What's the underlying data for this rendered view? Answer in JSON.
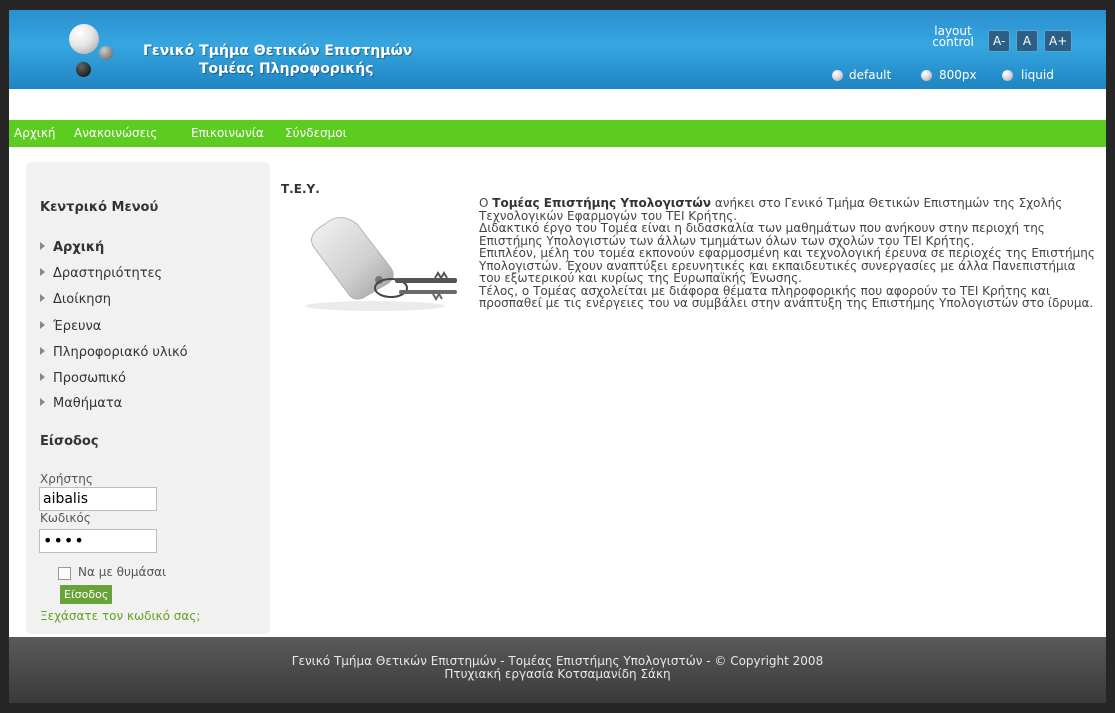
{
  "header": {
    "title_line1": "Γενικό Τμήμα Θετικών Επιστημών",
    "title_line2": "Τομέας Πληροφορικής",
    "layout_control_line1": "layout",
    "layout_control_line2": "control",
    "font_buttons": [
      "A-",
      "A",
      "A+"
    ],
    "layout_options": [
      "default",
      "800px",
      "liquid"
    ]
  },
  "nav": {
    "items": [
      "Αρχική",
      "Ανακοινώσεις",
      "Επικοινωνία",
      "Σύνδεσμοι"
    ]
  },
  "sidebar": {
    "menu_heading": "Κεντρικό Μενού",
    "menu_items": [
      "Αρχική",
      "Δραστηριότητες",
      "Διοίκηση",
      "Έρευνα",
      "Πληροφοριακό υλικό",
      "Προσωπικό",
      "Μαθήματα"
    ],
    "login_heading": "Είσοδος",
    "username_label": "Χρήστης",
    "username_value": "aibalis",
    "password_label": "Κωδικός",
    "password_value": "••••",
    "remember_label": "Να με θυμάσαι",
    "login_button": "Είσοδος",
    "forgot_link": "Ξεχάσατε τον κωδικό σας;"
  },
  "content": {
    "title": "Τ.Ε.Υ.",
    "intro_bold": "Τομέας Επιστήμης Υπολογιστών",
    "p1_pre": "Ο ",
    "p1_post": " ανήκει στο Γενικό Τμήμα Θετικών Επιστημών της Σχολής Τεχνολογικών Εφαρμογών του ΤΕΙ Κρήτης.",
    "p2": "Διδακτικό έργο του Τομέα είναι η διδασκαλία των μαθημάτων που ανήκουν στην περιοχή της Επιστήμης Υπολογιστών των άλλων τμημάτων όλων των σχολών του ΤΕΙ Κρήτης.",
    "p3": "Επιπλέον, μέλη του τομέα εκπονούν εφαρμοσμένη και τεχνολογική έρευνα σε περιοχές της Επιστήμης Υπολογιστών. Έχουν αναπτύξει ερευνητικές και εκπαιδευτικές συνεργασίες με άλλα Πανεπιστήμια του εξωτερικού και κυρίως της Ευρωπαϊκής Ένωσης.",
    "p4": "Τέλος, ο Τομέας ασχολείται με διάφορα θέματα πληροφορικής που αφορούν το ΤΕΙ Κρήτης και προσπαθεί με τις ενέργειες του να συμβάλει στην ανάπτυξη της Επιστήμης Υπολογιστών στο ίδρυμα."
  },
  "footer": {
    "line1": "Γενικό Τμήμα Θετικών Επιστημών - Τομέας Επιστήμης Υπολογιστών - © Copyright 2008",
    "line2": "Πτυχιακή εργασία Κοτσαμανίδη Σάκη"
  },
  "colors": {
    "header_blue": "#2a8fce",
    "nav_green": "#5ccc21",
    "link_green": "#62a221",
    "footer_dark": "#3a3a3a"
  }
}
